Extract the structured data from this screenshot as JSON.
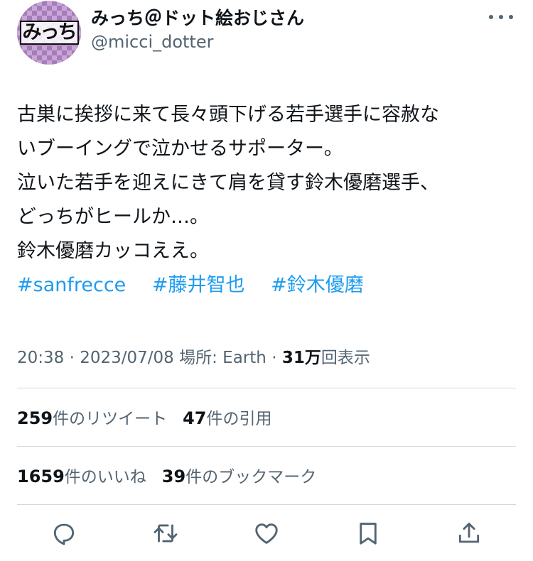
{
  "user": {
    "avatar_text": "みっち",
    "display_name": "みっち＠ドット絵おじさん",
    "handle": "@micci_dotter"
  },
  "tweet": {
    "lines": [
      "古巣に挨拶に来て長々頭下げる若手選手に容赦な",
      "いブーイングで泣かせるサポーター。",
      "泣いた若手を迎えにきて肩を貸す鈴木優磨選手、",
      "どっちがヒールか…。",
      "鈴木優磨カッコええ。"
    ],
    "hashtags": [
      "#sanfrecce",
      "#藤井智也",
      "#鈴木優磨"
    ]
  },
  "meta": {
    "time": "20:38",
    "date": "2023/07/08",
    "location_label": "場所: Earth",
    "separator": "·",
    "views_count": "31万",
    "views_label": "回表示"
  },
  "stats": {
    "retweets": {
      "count": "259",
      "label": "件のリツイート"
    },
    "quotes": {
      "count": "47",
      "label": "件の引用"
    },
    "likes": {
      "count": "1659",
      "label": "件のいいね"
    },
    "bookmarks": {
      "count": "39",
      "label": "件のブックマーク"
    }
  },
  "actions": [
    "reply-icon",
    "retweet-icon",
    "like-icon",
    "bookmark-icon",
    "share-icon"
  ],
  "colors": {
    "link": "#1d9bf0",
    "secondary_text": "#536471",
    "primary_text": "#0f1419",
    "divider": "#cfd9de"
  }
}
